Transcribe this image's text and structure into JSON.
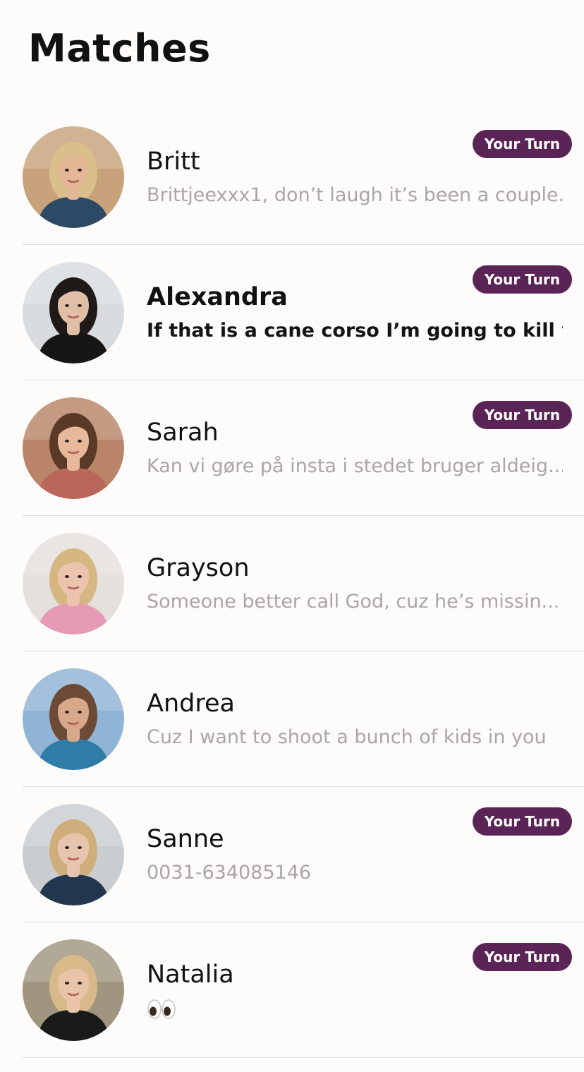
{
  "header": {
    "title": "Matches"
  },
  "matches": [
    {
      "name": "Britt",
      "preview": "Brittjeexxx1, don’t laugh it’s been a couple...",
      "badge": "Your Turn",
      "unread": false,
      "avatar": {
        "bg": "#c7a27a",
        "skin": "#e4b896",
        "hair": "#d9bf8a",
        "top": "#2c4a66"
      }
    },
    {
      "name": "Alexandra",
      "preview": "If that is a cane corso I’m going to kill yo...",
      "badge": "Your Turn",
      "unread": true,
      "avatar": {
        "bg": "#d8dcdf",
        "skin": "#e1bfa6",
        "hair": "#1f1a18",
        "top": "#161616"
      }
    },
    {
      "name": "Sarah",
      "preview": "Kan vi gøre på insta i stedet bruger aldeig...",
      "badge": "Your Turn",
      "unread": false,
      "avatar": {
        "bg": "#b98468",
        "skin": "#e7b89a",
        "hair": "#5a3a27",
        "top": "#b9675a"
      }
    },
    {
      "name": "Grayson",
      "preview": "Someone better call God, cuz he’s missin...",
      "badge": "",
      "unread": false,
      "avatar": {
        "bg": "#e4e0dc",
        "skin": "#ecc3ad",
        "hair": "#d6b782",
        "top": "#e79ab6"
      }
    },
    {
      "name": "Andrea",
      "preview": "Cuz I want to shoot a bunch of kids in you",
      "badge": "",
      "unread": false,
      "avatar": {
        "bg": "#8fb4d6",
        "skin": "#d7a98a",
        "hair": "#6d4a36",
        "top": "#2f7ca6"
      }
    },
    {
      "name": "Sanne",
      "preview": "0031-634085146",
      "badge": "Your Turn",
      "unread": false,
      "avatar": {
        "bg": "#c9cdd0",
        "skin": "#e6c4ae",
        "hair": "#cfae7c",
        "top": "#23364f"
      }
    },
    {
      "name": "Natalia",
      "preview": "",
      "preview_emoji": "eyes-emoji",
      "badge": "Your Turn",
      "unread": false,
      "avatar": {
        "bg": "#a0957f",
        "skin": "#e9c4a8",
        "hair": "#d8b98a",
        "top": "#1a1a1a"
      }
    }
  ]
}
